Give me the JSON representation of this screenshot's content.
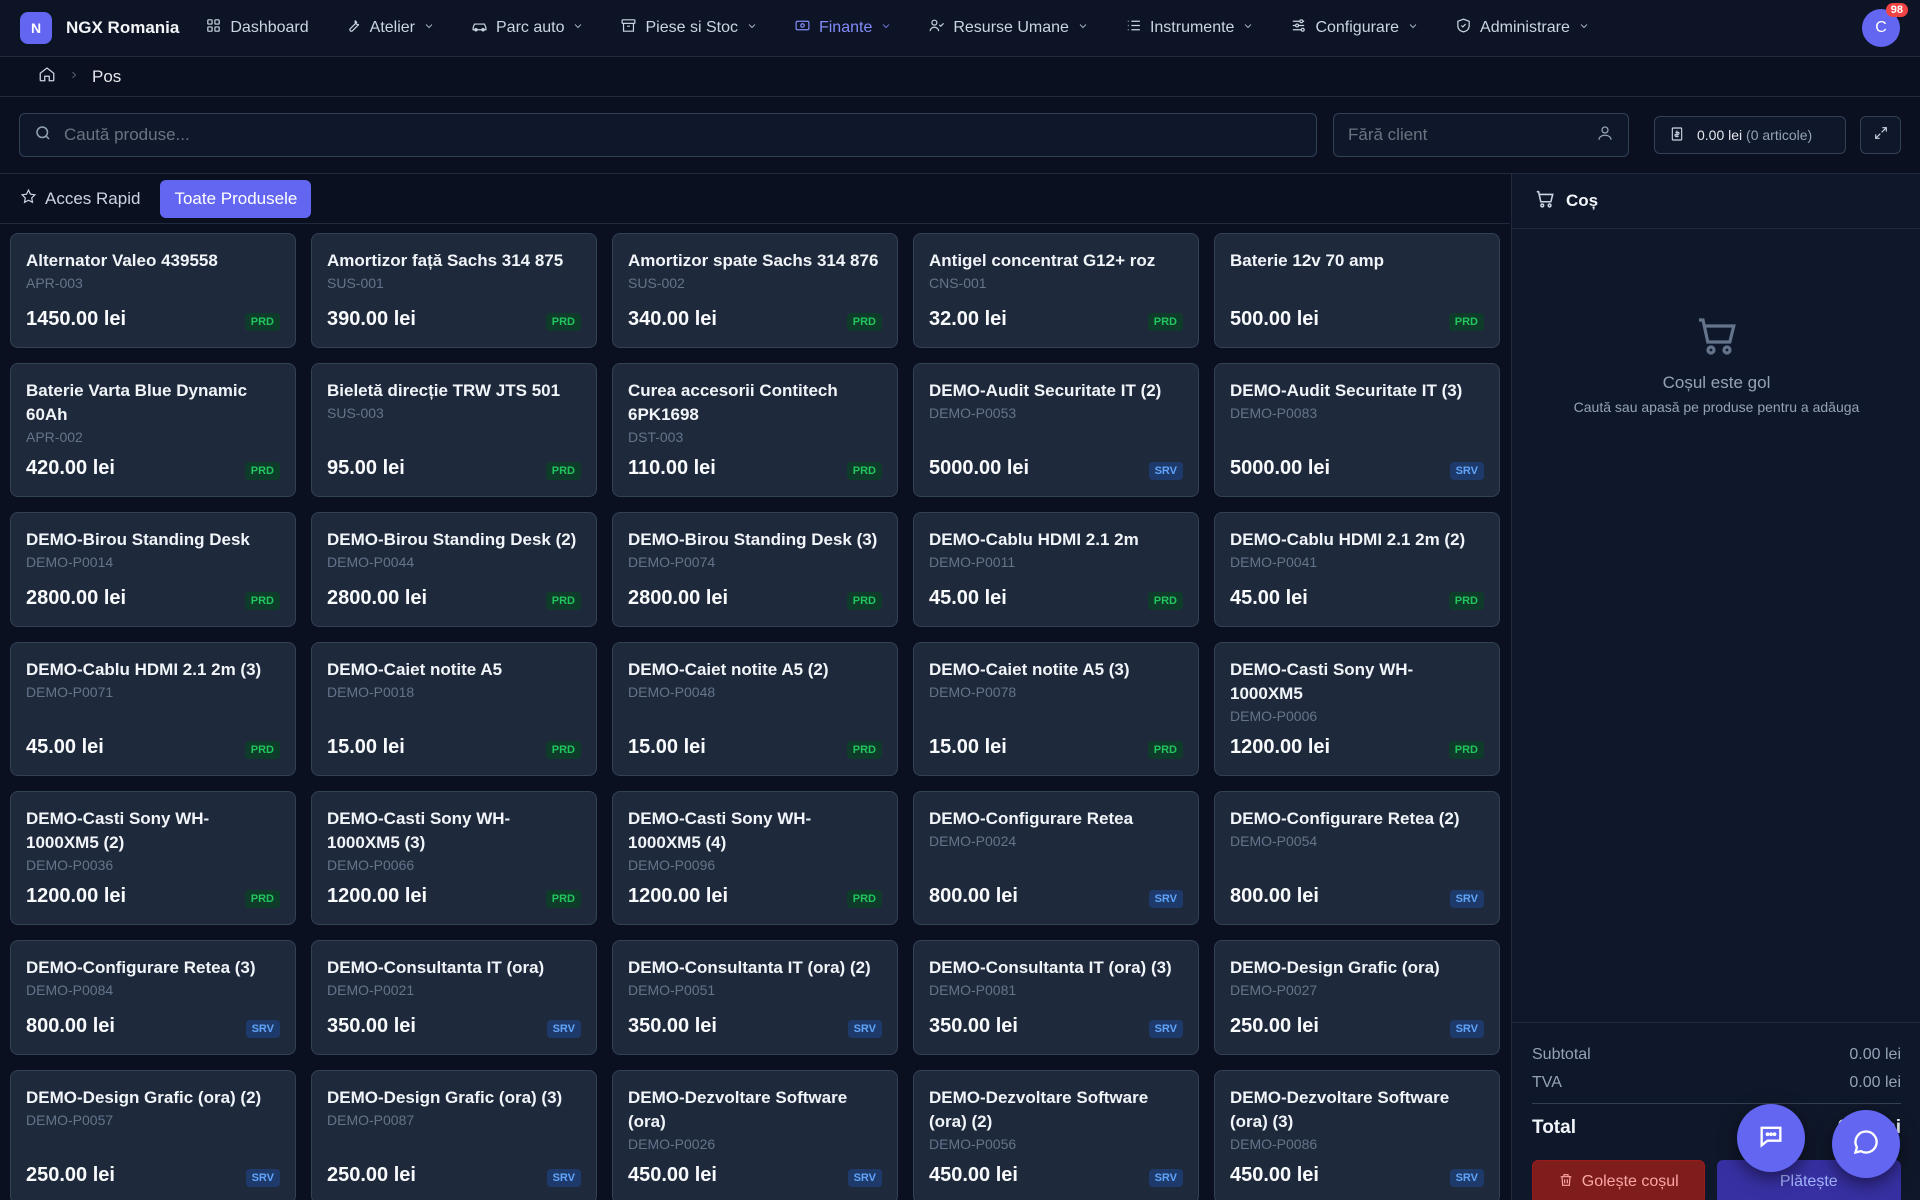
{
  "brand": {
    "logo_letter": "N",
    "name": "NGX Romania"
  },
  "nav": [
    {
      "label": "Dashboard",
      "icon": "dashboard-icon",
      "dropdown": false,
      "active": false
    },
    {
      "label": "Atelier",
      "icon": "wrench-icon",
      "dropdown": true,
      "active": false
    },
    {
      "label": "Parc auto",
      "icon": "car-icon",
      "dropdown": true,
      "active": false
    },
    {
      "label": "Piese si Stoc",
      "icon": "archive-icon",
      "dropdown": true,
      "active": false
    },
    {
      "label": "Finante",
      "icon": "banknote-icon",
      "dropdown": true,
      "active": true
    },
    {
      "label": "Resurse Umane",
      "icon": "users-icon",
      "dropdown": true,
      "active": false
    },
    {
      "label": "Instrumente",
      "icon": "list-icon",
      "dropdown": true,
      "active": false
    },
    {
      "label": "Configurare",
      "icon": "sliders-icon",
      "dropdown": true,
      "active": false
    },
    {
      "label": "Administrare",
      "icon": "shield-icon",
      "dropdown": true,
      "active": false
    }
  ],
  "user": {
    "avatar_letter": "C",
    "notifications": "98"
  },
  "breadcrumb": {
    "current": "Pos"
  },
  "search": {
    "placeholder": "Caută produse...",
    "value": ""
  },
  "client": {
    "placeholder": "Fără client",
    "value": ""
  },
  "cart_summary": {
    "amount": "0.00 lei",
    "count": "(0 articole)"
  },
  "tabs": [
    {
      "label": "Acces Rapid",
      "active": false
    },
    {
      "label": "Toate Produsele",
      "active": true
    }
  ],
  "products": [
    {
      "name": "Alternator Valeo 439558",
      "code": "APR-003",
      "price": "1450.00 lei",
      "type": "PRD"
    },
    {
      "name": "Amortizor față Sachs 314 875",
      "code": "SUS-001",
      "price": "390.00 lei",
      "type": "PRD"
    },
    {
      "name": "Amortizor spate Sachs 314 876",
      "code": "SUS-002",
      "price": "340.00 lei",
      "type": "PRD"
    },
    {
      "name": "Antigel concentrat G12+ roz",
      "code": "CNS-001",
      "price": "32.00 lei",
      "type": "PRD"
    },
    {
      "name": "Baterie 12v 70 amp",
      "code": "",
      "price": "500.00 lei",
      "type": "PRD"
    },
    {
      "name": "Baterie Varta Blue Dynamic 60Ah",
      "code": "APR-002",
      "price": "420.00 lei",
      "type": "PRD"
    },
    {
      "name": "Bieletă direcție TRW JTS 501",
      "code": "SUS-003",
      "price": "95.00 lei",
      "type": "PRD"
    },
    {
      "name": "Curea accesorii Contitech 6PK1698",
      "code": "DST-003",
      "price": "110.00 lei",
      "type": "PRD"
    },
    {
      "name": "DEMO-Audit Securitate IT (2)",
      "code": "DEMO-P0053",
      "price": "5000.00 lei",
      "type": "SRV"
    },
    {
      "name": "DEMO-Audit Securitate IT (3)",
      "code": "DEMO-P0083",
      "price": "5000.00 lei",
      "type": "SRV"
    },
    {
      "name": "DEMO-Birou Standing Desk",
      "code": "DEMO-P0014",
      "price": "2800.00 lei",
      "type": "PRD"
    },
    {
      "name": "DEMO-Birou Standing Desk (2)",
      "code": "DEMO-P0044",
      "price": "2800.00 lei",
      "type": "PRD"
    },
    {
      "name": "DEMO-Birou Standing Desk (3)",
      "code": "DEMO-P0074",
      "price": "2800.00 lei",
      "type": "PRD"
    },
    {
      "name": "DEMO-Cablu HDMI 2.1 2m",
      "code": "DEMO-P0011",
      "price": "45.00 lei",
      "type": "PRD"
    },
    {
      "name": "DEMO-Cablu HDMI 2.1 2m (2)",
      "code": "DEMO-P0041",
      "price": "45.00 lei",
      "type": "PRD"
    },
    {
      "name": "DEMO-Cablu HDMI 2.1 2m (3)",
      "code": "DEMO-P0071",
      "price": "45.00 lei",
      "type": "PRD"
    },
    {
      "name": "DEMO-Caiet notite A5",
      "code": "DEMO-P0018",
      "price": "15.00 lei",
      "type": "PRD"
    },
    {
      "name": "DEMO-Caiet notite A5 (2)",
      "code": "DEMO-P0048",
      "price": "15.00 lei",
      "type": "PRD"
    },
    {
      "name": "DEMO-Caiet notite A5 (3)",
      "code": "DEMO-P0078",
      "price": "15.00 lei",
      "type": "PRD"
    },
    {
      "name": "DEMO-Casti Sony WH-1000XM5",
      "code": "DEMO-P0006",
      "price": "1200.00 lei",
      "type": "PRD"
    },
    {
      "name": "DEMO-Casti Sony WH-1000XM5 (2)",
      "code": "DEMO-P0036",
      "price": "1200.00 lei",
      "type": "PRD"
    },
    {
      "name": "DEMO-Casti Sony WH-1000XM5 (3)",
      "code": "DEMO-P0066",
      "price": "1200.00 lei",
      "type": "PRD"
    },
    {
      "name": "DEMO-Casti Sony WH-1000XM5 (4)",
      "code": "DEMO-P0096",
      "price": "1200.00 lei",
      "type": "PRD"
    },
    {
      "name": "DEMO-Configurare Retea",
      "code": "DEMO-P0024",
      "price": "800.00 lei",
      "type": "SRV"
    },
    {
      "name": "DEMO-Configurare Retea (2)",
      "code": "DEMO-P0054",
      "price": "800.00 lei",
      "type": "SRV"
    },
    {
      "name": "DEMO-Configurare Retea (3)",
      "code": "DEMO-P0084",
      "price": "800.00 lei",
      "type": "SRV"
    },
    {
      "name": "DEMO-Consultanta IT (ora)",
      "code": "DEMO-P0021",
      "price": "350.00 lei",
      "type": "SRV"
    },
    {
      "name": "DEMO-Consultanta IT (ora) (2)",
      "code": "DEMO-P0051",
      "price": "350.00 lei",
      "type": "SRV"
    },
    {
      "name": "DEMO-Consultanta IT (ora) (3)",
      "code": "DEMO-P0081",
      "price": "350.00 lei",
      "type": "SRV"
    },
    {
      "name": "DEMO-Design Grafic (ora)",
      "code": "DEMO-P0027",
      "price": "250.00 lei",
      "type": "SRV"
    },
    {
      "name": "DEMO-Design Grafic (ora) (2)",
      "code": "DEMO-P0057",
      "price": "250.00 lei",
      "type": "SRV"
    },
    {
      "name": "DEMO-Design Grafic (ora) (3)",
      "code": "DEMO-P0087",
      "price": "250.00 lei",
      "type": "SRV"
    },
    {
      "name": "DEMO-Dezvoltare Software (ora)",
      "code": "DEMO-P0026",
      "price": "450.00 lei",
      "type": "SRV"
    },
    {
      "name": "DEMO-Dezvoltare Software (ora) (2)",
      "code": "DEMO-P0056",
      "price": "450.00 lei",
      "type": "SRV"
    },
    {
      "name": "DEMO-Dezvoltare Software (ora) (3)",
      "code": "DEMO-P0086",
      "price": "450.00 lei",
      "type": "SRV"
    }
  ],
  "cart": {
    "title": "Coș",
    "empty_title": "Coșul este gol",
    "empty_subtitle": "Caută sau apasă pe produse pentru a adăuga",
    "subtotal_label": "Subtotal",
    "subtotal_value": "0.00 lei",
    "tva_label": "TVA",
    "tva_value": "0.00 lei",
    "total_label": "Total",
    "total_value": "0.00 lei",
    "clear_label": "Golește coșul",
    "pay_label": "Plătește"
  }
}
